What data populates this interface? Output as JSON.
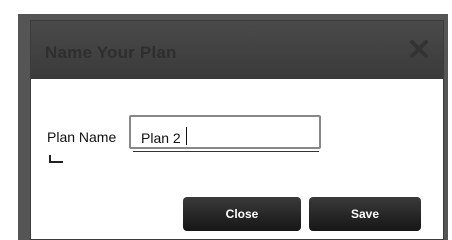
{
  "dialog": {
    "title": "Name Your Plan",
    "close_icon": "close-icon",
    "field_label": "Plan Name",
    "plan_name_value": "Plan 2",
    "buttons": {
      "close_label": "Close",
      "save_label": "Save"
    }
  }
}
